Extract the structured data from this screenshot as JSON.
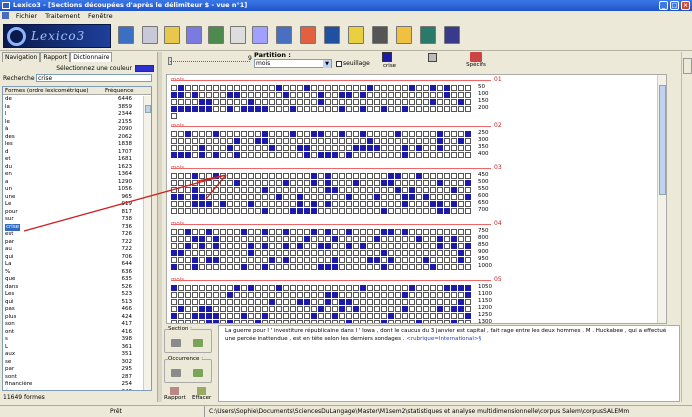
{
  "window": {
    "title": "Lexico3 - [Sections  découpées d'après le délimiteur  $ - vue n°1]",
    "controls": [
      "_",
      "□",
      "×"
    ]
  },
  "menu": [
    "Fichier",
    "Traitement",
    "Fenêtre"
  ],
  "logo_text": "Lexico3",
  "toolbar_icons": [
    "stats-icon",
    "folder-icon",
    "documents-icon",
    "segments-icon",
    "concordance-icon",
    "pdf-icon",
    "grid-icon",
    "chart-icon",
    "tree-icon",
    "arrow-icon",
    "dictionary-icon",
    "print-icon",
    "help-icon",
    "exit-icon",
    "book-icon"
  ],
  "left_panel": {
    "tabs": [
      "Navigation",
      "Rapport",
      "Dictionnaire"
    ],
    "color_label": "Sélectionnez une couleur",
    "search_label": "Recherche :",
    "search_value": "crise",
    "columns": [
      "Formes (ordre lexicométrique)",
      "Fréquence"
    ],
    "rows": [
      {
        "w": "de",
        "f": "6446"
      },
      {
        "w": "la",
        "f": "3859"
      },
      {
        "w": "l",
        "f": "2344"
      },
      {
        "w": "le",
        "f": "2155"
      },
      {
        "w": "à",
        "f": "2090"
      },
      {
        "w": "des",
        "f": "2062"
      },
      {
        "w": "les",
        "f": "1838"
      },
      {
        "w": "d",
        "f": "1707"
      },
      {
        "w": "et",
        "f": "1681"
      },
      {
        "w": "du",
        "f": "1623"
      },
      {
        "w": "en",
        "f": "1364"
      },
      {
        "w": "a",
        "f": "1290"
      },
      {
        "w": "un",
        "f": "1056"
      },
      {
        "w": "une",
        "f": "965"
      },
      {
        "w": "Le",
        "f": "919"
      },
      {
        "w": "pour",
        "f": "817"
      },
      {
        "w": "sur",
        "f": "738"
      },
      {
        "w": "crise",
        "f": "736",
        "sel": true
      },
      {
        "w": "est",
        "f": "726"
      },
      {
        "w": "par",
        "f": "722"
      },
      {
        "w": "au",
        "f": "722"
      },
      {
        "w": "qui",
        "f": "706"
      },
      {
        "w": "La",
        "f": "644"
      },
      {
        "w": "%",
        "f": "636"
      },
      {
        "w": "que",
        "f": "635"
      },
      {
        "w": "dans",
        "f": "526"
      },
      {
        "w": "Les",
        "f": "523"
      },
      {
        "w": "qui",
        "f": "513"
      },
      {
        "w": "pas",
        "f": "466"
      },
      {
        "w": "plus",
        "f": "424"
      },
      {
        "w": "son",
        "f": "417"
      },
      {
        "w": "ont",
        "f": "416"
      },
      {
        "w": "s",
        "f": "398"
      },
      {
        "w": "L",
        "f": "361"
      },
      {
        "w": "aux",
        "f": "351"
      },
      {
        "w": "se",
        "f": "302"
      },
      {
        "w": "par",
        "f": "295"
      },
      {
        "w": "sont",
        "f": "287"
      },
      {
        "w": "financière",
        "f": "254"
      },
      {
        "w": "économie",
        "f": "246"
      }
    ],
    "count": "11649 formes"
  },
  "partition": {
    "slider_value": "9",
    "label": "Partition :",
    "value": "mois",
    "seuillage": "seuillage",
    "color_word": "crise",
    "specifs": "Spécifs"
  },
  "sections": [
    {
      "label": "mois",
      "num": "01",
      "rownums": [
        "50",
        "100",
        "150",
        "200"
      ],
      "seed": 3
    },
    {
      "label": "mois",
      "num": "02",
      "rownums": [
        "250",
        "300",
        "350",
        "400"
      ],
      "seed": 7
    },
    {
      "label": "mois",
      "num": "03",
      "rownums": [
        "450",
        "500",
        "550",
        "600",
        "650",
        "700"
      ],
      "seed": 11
    },
    {
      "label": "mois",
      "num": "04",
      "rownums": [
        "750",
        "800",
        "850",
        "900",
        "950",
        "1000"
      ],
      "seed": 17
    },
    {
      "label": "mois",
      "num": "05",
      "rownums": [
        "1050",
        "1100",
        "1150",
        "1200",
        "1250",
        "1300"
      ],
      "seed": 23
    }
  ],
  "controls": {
    "section_label": "Section :",
    "occurrence_label": "Occurrence :",
    "rapport": "Rapport",
    "effacer": "Effacer"
  },
  "context": {
    "text": "La guerre pour l ' investiture républicaine dans l ' Iowa , dont le caucus du 3 janvier est capital , fait rage entre les deux hommes . M . Huckabee , qui a effectué une percée inattendue , est en tête selon les derniers sondages .",
    "tag": "<rubrique=International>§"
  },
  "status": {
    "ready": "Prêt",
    "path": "C:\\Users\\Sophie\\Documents\\SciencesDuLangage\\Master\\M1sem2\\statistiques et analyse multidimensionnelle\\corpus Salem\\corpusSALEMm"
  },
  "colors": {
    "accent": "#1b1ba8",
    "title": "#1f53c9",
    "red": "#c02020"
  }
}
